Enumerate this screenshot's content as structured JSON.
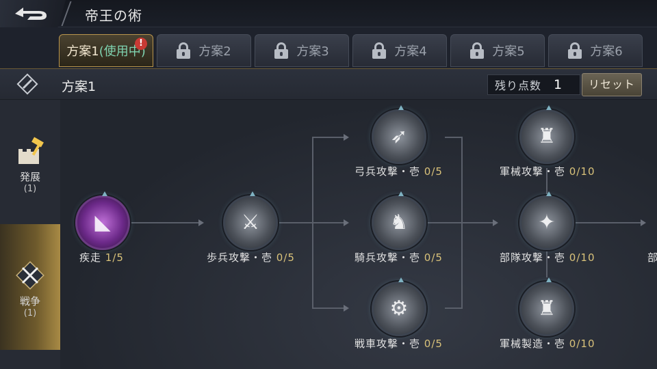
{
  "header": {
    "title": "帝王の術"
  },
  "tabs": [
    {
      "label": "方案1",
      "status": "(使用中)",
      "alert": "!"
    },
    {
      "label": "方案2"
    },
    {
      "label": "方案3"
    },
    {
      "label": "方案4"
    },
    {
      "label": "方案5"
    },
    {
      "label": "方案6"
    }
  ],
  "plan": {
    "name": "方案1",
    "points_label": "残り点数",
    "points_value": "1",
    "reset_label": "リセット"
  },
  "sidebar": [
    {
      "label": "発展",
      "count": "(1)",
      "icon": "hammer-castle-icon"
    },
    {
      "label": "戦争",
      "count": "(1)",
      "icon": "crossed-swords-icon"
    }
  ],
  "skills": [
    {
      "name": "疾走",
      "level": "1/5",
      "icon": "boot-icon"
    },
    {
      "name": "歩兵攻撃・壱",
      "level": "0/5",
      "icon": "infantry-icon"
    },
    {
      "name": "弓兵攻撃・壱",
      "level": "0/5",
      "icon": "archer-icon"
    },
    {
      "name": "騎兵攻撃・壱",
      "level": "0/5",
      "icon": "cavalry-icon"
    },
    {
      "name": "戦車攻撃・壱",
      "level": "0/5",
      "icon": "cannon-icon"
    },
    {
      "name": "軍械攻撃・壱",
      "level": "0/10",
      "icon": "siege-tower-icon"
    },
    {
      "name": "部隊攻撃・壱",
      "level": "0/10",
      "icon": "troop-blade-icon"
    },
    {
      "name": "軍械製造・壱",
      "level": "0/10",
      "icon": "siege-build-icon"
    },
    {
      "name": "部"
    }
  ],
  "colors": {
    "accent_gold": "#b9954d",
    "in_use_green": "#7fd3b0",
    "level_gold": "#d9c27a",
    "alert_red": "#c83a34"
  }
}
